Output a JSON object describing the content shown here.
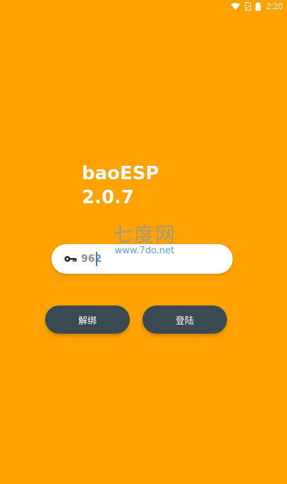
{
  "status_bar": {
    "time": "2:20",
    "icons": [
      "wifi-icon",
      "sim-icon",
      "battery-icon"
    ]
  },
  "app": {
    "name": "baoESP",
    "version": "2.0.7"
  },
  "watermark": {
    "logo": "七度网",
    "url": "www.7do.net"
  },
  "key_field": {
    "icon": "key-icon",
    "value": "962"
  },
  "buttons": {
    "unbind_label": "解绑",
    "login_label": "登陆"
  },
  "colors": {
    "background": "#FFA202",
    "button": "#3B4A52",
    "caret": "#2F80D8"
  }
}
